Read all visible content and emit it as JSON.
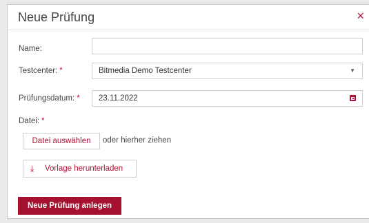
{
  "dialog": {
    "title": "Neue Prüfung",
    "close_icon": "×"
  },
  "form": {
    "name": {
      "label": "Name:",
      "value": ""
    },
    "testcenter": {
      "label": "Testcenter:",
      "required_mark": "*",
      "value": "Bitmedia Demo Testcenter",
      "caret": "▼"
    },
    "date": {
      "label": "Prüfungsdatum:",
      "required_mark": "*",
      "value": "23.11.2022",
      "icon": "calendar-icon"
    },
    "file": {
      "label": "Datei:",
      "required_mark": "*",
      "choose_button": "Datei auswählen",
      "drop_hint": "oder hierher ziehen"
    },
    "download_template": {
      "label": "Vorlage herunterladen",
      "icon": "⤓"
    }
  },
  "actions": {
    "submit_label": "Neue Prüfung anlegen"
  },
  "colors": {
    "accent": "#b01030",
    "button_bg": "#a5112e"
  }
}
